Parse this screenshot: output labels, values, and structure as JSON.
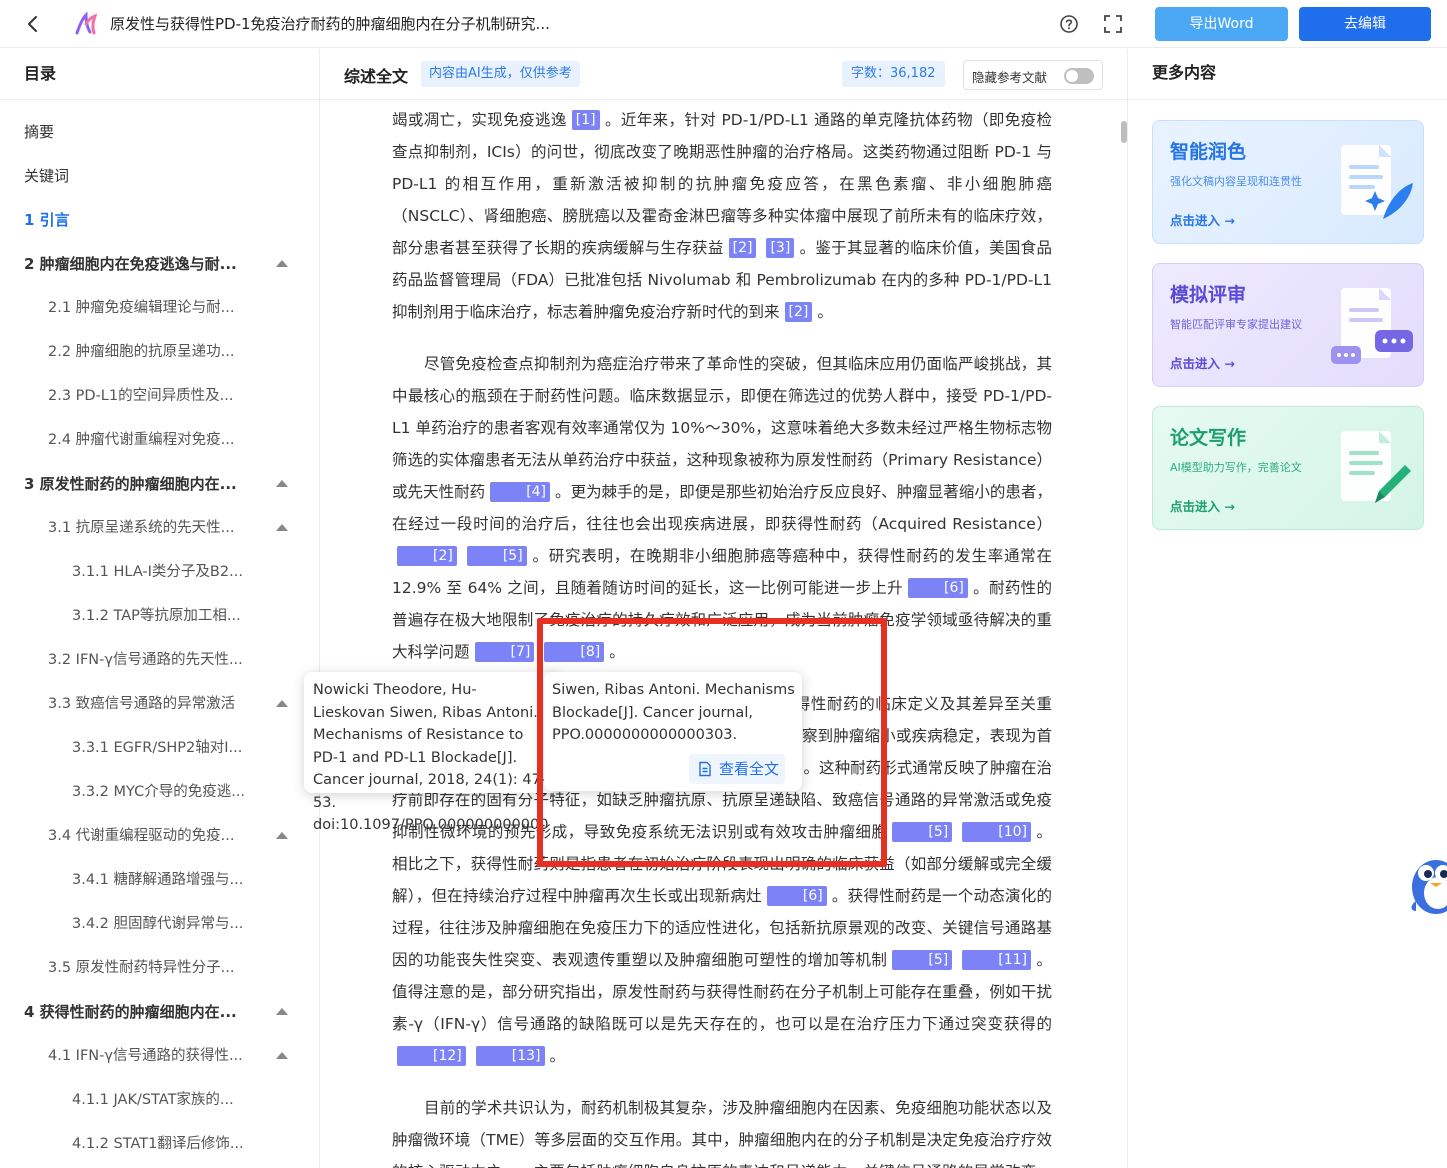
{
  "header": {
    "title": "原发性与获得性PD-1免疫治疗耐药的肿瘤细胞内在分子机制研究...",
    "export_label": "导出Word",
    "edit_label": "去编辑",
    "icons": [
      "back-arrow-icon",
      "logo-icon",
      "help-icon",
      "fullscreen-icon"
    ]
  },
  "sidebar": {
    "title": "目录",
    "items": [
      {
        "label": "摘要",
        "level": 0
      },
      {
        "label": "关键词",
        "level": 0
      },
      {
        "label": "1 引言",
        "level": 0,
        "active": true
      },
      {
        "label": "2 肿瘤细胞内在免疫逃逸与耐...",
        "level": 0,
        "bold": true,
        "expanded": true
      },
      {
        "label": "2.1 肿瘤免疫编辑理论与耐...",
        "level": 1
      },
      {
        "label": "2.2 肿瘤细胞的抗原呈递功...",
        "level": 1
      },
      {
        "label": "2.3 PD-L1的空间异质性及...",
        "level": 1
      },
      {
        "label": "2.4 肿瘤代谢重编程对免疫...",
        "level": 1
      },
      {
        "label": "3 原发性耐药的肿瘤细胞内在...",
        "level": 0,
        "bold": true,
        "expanded": true
      },
      {
        "label": "3.1 抗原呈递系统的先天性...",
        "level": 1,
        "expanded": true
      },
      {
        "label": "3.1.1 HLA-I类分子及B2...",
        "level": 2
      },
      {
        "label": "3.1.2 TAP等抗原加工相...",
        "level": 2
      },
      {
        "label": "3.2 IFN-γ信号通路的先天性...",
        "level": 1
      },
      {
        "label": "3.3 致癌信号通路的异常激活",
        "level": 1,
        "expanded": true
      },
      {
        "label": "3.3.1 EGFR/SHP2轴对I...",
        "level": 2
      },
      {
        "label": "3.3.2 MYC介导的免疫逃...",
        "level": 2
      },
      {
        "label": "3.4 代谢重编程驱动的免疫...",
        "level": 1,
        "expanded": true
      },
      {
        "label": "3.4.1 糖酵解通路增强与...",
        "level": 2
      },
      {
        "label": "3.4.2 胆固醇代谢异常与...",
        "level": 2
      },
      {
        "label": "3.5 原发性耐药特异性分子...",
        "level": 1
      },
      {
        "label": "4 获得性耐药的肿瘤细胞内在...",
        "level": 0,
        "bold": true,
        "expanded": true
      },
      {
        "label": "4.1 IFN-γ信号通路的获得性...",
        "level": 1,
        "expanded": true
      },
      {
        "label": "4.1.1 JAK/STAT家族的...",
        "level": 2
      },
      {
        "label": "4.1.2 STAT1翻译后修饰...",
        "level": 2
      }
    ]
  },
  "main": {
    "title": "综述全文",
    "ai_badge": "内容由AI生成，仅供参考",
    "word_count": "字数：36,182",
    "hide_refs_label": "隐藏参考文献",
    "hide_refs_on": false,
    "paragraphs": [
      [
        {
          "t": "竭或凋亡，实现免疫逃逸"
        },
        {
          "c": "[1]"
        },
        {
          "t": "。近年来，针对 PD-1/PD-L1 通路的单克隆抗体药物（即免疫检查点抑制剂，ICIs）的问世，彻底改变了晚期恶性肿瘤的治疗格局。这类药物通过阻断 PD-1 与 PD-L1 的相互作用，重新激活被抑制的抗肿瘤免疫应答，在黑色素瘤、非小细胞肺癌（NSCLC）、肾细胞癌、膀胱癌以及霍奇金淋巴瘤等多种实体瘤中展现了前所未有的临床疗效，部分患者甚至获得了长期的疾病缓解与生存获益"
        },
        {
          "c": "[2]"
        },
        {
          "c": "[3]"
        },
        {
          "t": "。鉴于其显著的临床价值，美国食品药品监督管理局（FDA）已批准包括 Nivolumab 和 Pembrolizumab 在内的多种 PD-1/PD-L1 抑制剂用于临床治疗，标志着肿瘤免疫治疗新时代的到来"
        },
        {
          "c": "[2]"
        },
        {
          "t": "。"
        }
      ],
      [
        {
          "t": "尽管免疫检查点抑制剂为癌症治疗带来了革命性的突破，但其临床应用仍面临严峻挑战，其中最核心的瓶颈在于耐药性问题。临床数据显示，即便在筛选过的优势人群中，接受 PD-1/PD-L1 单药治疗的患者客观有效率通常仅为 10%～30%，这意味着绝大多数未经过严格生物标志物筛选的实体瘤患者无法从单药治疗中获益，这种现象被称为原发性耐药（Primary Resistance）或先天性耐药"
        },
        {
          "c": "[4]"
        },
        {
          "t": "。更为棘手的是，即便是那些初始治疗反应良好、肿瘤显著缩小的患者，在经过一段时间的治疗后，往往也会出现疾病进展，即获得性耐药（Acquired Resistance）"
        },
        {
          "c": "[2]"
        },
        {
          "c": "[5]"
        },
        {
          "t": "。研究表明，在晚期非小细胞肺癌等癌种中，获得性耐药的发生率通常在 12.9% 至 64% 之间，且随着随访时间的延长，这一比例可能进一步上升"
        },
        {
          "c": "[6]"
        },
        {
          "t": "。耐药性的普遍存在极大地限制了免疫治疗的持久疗效和广泛应用，成为当前肿瘤免疫学领域亟待解决的重大科学问题"
        },
        {
          "c": "[7]"
        },
        {
          "c": "[8]"
        },
        {
          "t": "。"
        }
      ],
      [
        {
          "t": "从临床表型和分子机制的角度，厘清原发性耐药与获得性耐药的临床定义及其差异至关重要。原发性耐药指患者在接受 PD-1/PD-L1 治疗后，从未观察到肿瘤缩小或疾病稳定，表现为首次评估即疾病进展（Progressive Disease, PD）"
        },
        {
          "c": "[9]"
        },
        {
          "t": "。这种耐药形式通常反映了肿瘤在治疗前即存在的固有分子特征，如缺乏肿瘤抗原、抗原呈递缺陷、致癌信号通路的异常激活或免疫抑制性微环境的预先形成，导致免疫系统无法识别或有效攻击肿瘤细胞"
        },
        {
          "c": "[5]"
        },
        {
          "c": "[10]"
        },
        {
          "t": "。相比之下，获得性耐药则是指患者在初始治疗阶段表现出明确的临床获益（如部分缓解或完全缓解），但在持续治疗过程中肿瘤再次生长或出现新病灶"
        },
        {
          "c": "[6]"
        },
        {
          "t": "。获得性耐药是一个动态演化的过程，往往涉及肿瘤细胞在免疫压力下的适应性进化，包括新抗原景观的改变、关键信号通路基因的功能丧失性突变、表观遗传重塑以及肿瘤细胞可塑性的增加等机制"
        },
        {
          "c": "[5]"
        },
        {
          "c": "[11]"
        },
        {
          "t": "。值得注意的是，部分研究指出，原发性耐药与获得性耐药在分子机制上可能存在重叠，例如干扰素-γ（IFN-γ）信号通路的缺陷既可以是先天存在的，也可以是在治疗压力下通过突变获得的"
        },
        {
          "c": "[12]"
        },
        {
          "c": "[13]"
        },
        {
          "t": "。"
        }
      ],
      [
        {
          "t": "目前的学术共识认为，耐药机制极其复杂，涉及肿瘤细胞内在因素、免疫细胞功能状态以及肿瘤微环境（TME）等多层面的交互作用。其中，肿瘤细胞内在的分子机制是决定免疫治疗疗效的核心驱动力之一，主要包括肿瘤细胞自身抗原的表达和呈递能力、关键信号通路的异常改变，以及"
        }
      ]
    ]
  },
  "tooltips": [
    {
      "text": "Nowicki Theodore, Hu-Lieskovan Siwen, Ribas Antoni. Mechanisms of Resistance to PD-1 and PD-L1 Blockade[J]. Cancer journal, 2018, 24(1): 47-53. doi:10.1097/PPO.0000000000000303."
    },
    {
      "text": "Siwen, Ribas Antoni. Mechanisms Blockade[J]. Cancer journal, PPO.0000000000000303.",
      "action_label": "查看全文"
    }
  ],
  "right_panel": {
    "title": "更多内容",
    "cards": [
      {
        "title": "智能润色",
        "subtitle": "强化文稿内容呈现和连贯性",
        "link": "点击进入 →",
        "icon": "polish-doc-icon"
      },
      {
        "title": "模拟评审",
        "subtitle": "智能匹配评审专家提出建议",
        "link": "点击进入 →",
        "icon": "review-chat-icon"
      },
      {
        "title": "论文写作",
        "subtitle": "AI模型助力写作，完善论文",
        "link": "点击进入 →",
        "icon": "write-doc-icon"
      }
    ]
  },
  "colors": {
    "primary": "#1f6fec",
    "export_button": "#4ba8f5",
    "citation": "#7c83f6",
    "highlight_box": "#e53022"
  }
}
